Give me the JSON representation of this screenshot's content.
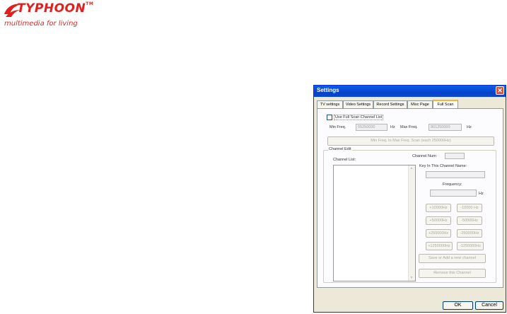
{
  "brand": {
    "name": "TYPHOON",
    "trademark": "TM",
    "tagline": "multimedia for living"
  },
  "dialog": {
    "title": "Settings",
    "tabs": [
      "TV settings",
      "Video Settings",
      "Record Settings",
      "Misc Page",
      "Full Scan"
    ],
    "active_tab": "Full Scan",
    "use_full_scan_label": "Use Full Scan Channel List",
    "min_freq_label": "Min Freq.",
    "min_freq_value": "55250000",
    "hz_label": "Hz",
    "max_freq_label": "Max Freq.",
    "max_freq_value": "801250000",
    "scan_button": "Min Freq. to Max Freq. Scan (each 250000Hz)",
    "channel_edit_legend": "Channel Edit",
    "channel_list_label": "Channel List:",
    "channel_num_label": "Channel Num:",
    "key_in_label": "Key In This Channel Name:",
    "frequency_label": "Frequency:",
    "step_buttons": [
      [
        "+10000Hz",
        "-10000 Hz"
      ],
      [
        "+50000Hz",
        "-50000Hz"
      ],
      [
        "+250000Hz",
        "-250000Hz"
      ],
      [
        "+1250000Hz",
        "-1250000Hz"
      ]
    ],
    "save_button": "Save or Add a new channel",
    "remove_button": "Remove this Channel",
    "ok_button": "OK",
    "cancel_button": "Cancel"
  }
}
